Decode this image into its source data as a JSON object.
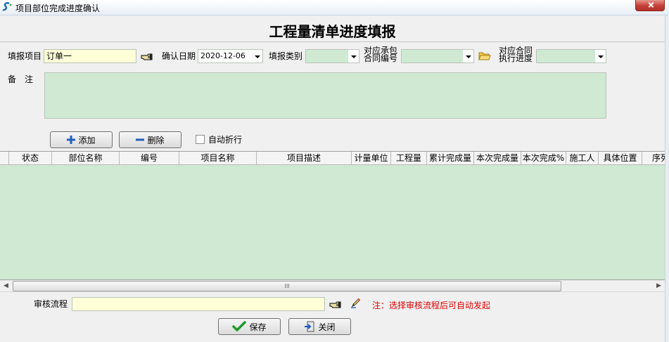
{
  "window": {
    "title": "项目部位完成进度确认"
  },
  "header": {
    "title": "工程量清单进度填报"
  },
  "form": {
    "project_label": "填报项目",
    "project_value": "订单一",
    "date_label": "确认日期",
    "date_value": "2020-12-06",
    "category_label": "填报类别",
    "category_value": "",
    "contract_label_1": "对应承包",
    "contract_label_2": "合同编号",
    "contract_value": "",
    "progress_label_1": "对应合同",
    "progress_label_2": "执行进度",
    "progress_value": "",
    "remark_label": "备　注",
    "remark_value": ""
  },
  "toolbar": {
    "add_label": "添加",
    "delete_label": "删除",
    "wrap_label": "自动折行",
    "wrap_checked": false
  },
  "grid": {
    "columns": [
      "状态",
      "部位名称",
      "编号",
      "项目名称",
      "项目描述",
      "计量单位",
      "工程量",
      "累计完成量",
      "本次完成量",
      "本次完成%",
      "施工人",
      "具体位置",
      "序列"
    ],
    "rows": []
  },
  "scrollbar": {
    "left_arrow": "◀",
    "right_arrow": "▶",
    "grip": "III"
  },
  "approval": {
    "label": "审核流程",
    "value": "",
    "note": "注：选择审核流程后可自动发起"
  },
  "footer": {
    "save_label": "保存",
    "close_label": "关闭"
  },
  "colors": {
    "field_green": "#cfe9d2",
    "field_yellow": "#ffffd8",
    "note_red": "#e00000",
    "accent_blue": "#1f5fbf"
  }
}
